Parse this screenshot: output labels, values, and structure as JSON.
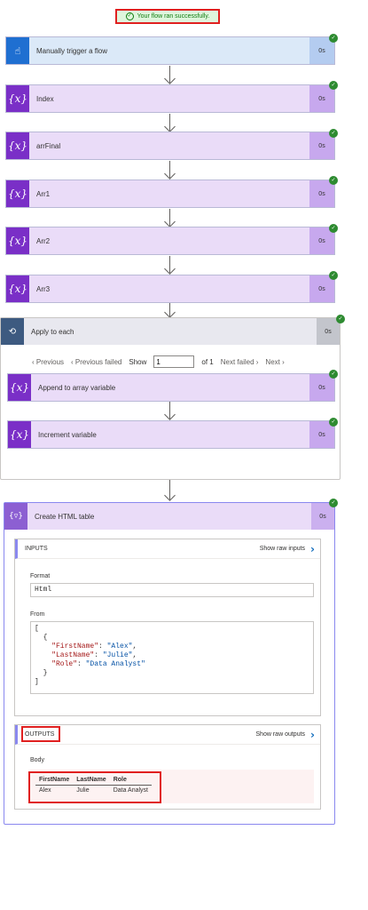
{
  "banner": {
    "text": "Your flow ran successfully.",
    "check": "✓"
  },
  "trigger": {
    "label": "Manually trigger a flow",
    "duration": "0s",
    "icon": "☝"
  },
  "variables": [
    {
      "label": "Index",
      "duration": "0s"
    },
    {
      "label": "arrFinal",
      "duration": "0s"
    },
    {
      "label": "Arr1",
      "duration": "0s"
    },
    {
      "label": "Arr2",
      "duration": "0s"
    },
    {
      "label": "Arr3",
      "duration": "0s"
    }
  ],
  "var_icon": "{x}",
  "apply_each": {
    "label": "Apply to each",
    "duration": "0s",
    "icon": "⟲",
    "pager": {
      "previous": "‹ Previous",
      "previous_failed": "‹ Previous failed",
      "show": "Show",
      "current": "1",
      "of": "of 1",
      "next_failed": "Next failed ›",
      "next": "Next ›"
    },
    "inner": [
      {
        "label": "Append to array variable",
        "duration": "0s"
      },
      {
        "label": "Increment variable",
        "duration": "0s"
      }
    ]
  },
  "html_table": {
    "label": "Create HTML table",
    "duration": "0s",
    "icon": "{▿}",
    "inputs": {
      "title": "INPUTS",
      "raw": "Show raw inputs",
      "chev": "›"
    },
    "format_label": "Format",
    "format_value": "Html",
    "from_label": "From",
    "from_lines": {
      "l1": "[",
      "l2": "  {",
      "k1": "\"FirstName\"",
      "v1": "\"Alex\"",
      "k2": "\"LastName\"",
      "v2": "\"Julie\"",
      "k3": "\"Role\"",
      "v3": "\"Data Analyst\"",
      "l6": "  }",
      "l7": "]"
    },
    "outputs": {
      "title": "OUTPUTS",
      "raw": "Show raw outputs",
      "chev": "›"
    },
    "body_label": "Body",
    "result": {
      "headers": [
        "FirstName",
        "LastName",
        "Role"
      ],
      "row": [
        "Alex",
        "Julie",
        "Data Analyst"
      ]
    }
  }
}
